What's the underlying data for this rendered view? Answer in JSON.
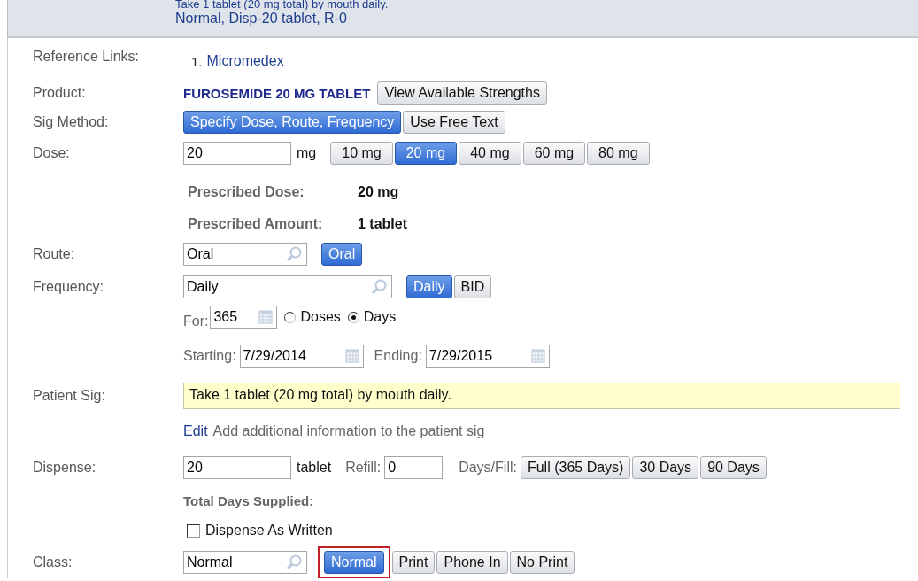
{
  "header": {
    "lines": [
      "Take 1 tablet (20 mg total) by mouth daily.",
      "Normal, Disp-20 tablet, R-0"
    ]
  },
  "reference_links": {
    "label": "Reference Links:",
    "links": [
      {
        "number": "1.",
        "text": "Micromedex"
      }
    ]
  },
  "product": {
    "label": "Product:",
    "name": "FUROSEMIDE 20 MG TABLET",
    "button": "View Available Strengths"
  },
  "sig_method": {
    "label": "Sig Method:",
    "options": [
      {
        "label": "Specify Dose, Route, Frequency",
        "selected": true
      },
      {
        "label": "Use Free Text",
        "selected": false
      }
    ]
  },
  "dose": {
    "label": "Dose:",
    "value": "20",
    "unit": "mg",
    "options": [
      {
        "label": "10 mg",
        "selected": false
      },
      {
        "label": "20 mg",
        "selected": true
      },
      {
        "label": "40 mg",
        "selected": false
      },
      {
        "label": "60 mg",
        "selected": false
      },
      {
        "label": "80 mg",
        "selected": false
      }
    ]
  },
  "prescribed": [
    {
      "label": "Prescribed Dose:",
      "value": "20 mg"
    },
    {
      "label": "Prescribed Amount:",
      "value": "1 tablet"
    }
  ],
  "route": {
    "label": "Route:",
    "value": "Oral",
    "options": [
      {
        "label": "Oral",
        "selected": true
      }
    ]
  },
  "frequency": {
    "label": "Frequency:",
    "value": "Daily",
    "options": [
      {
        "label": "Daily",
        "selected": true
      },
      {
        "label": "BID",
        "selected": false
      }
    ]
  },
  "duration": {
    "label": "For:",
    "value": "365",
    "units": [
      {
        "label": "Doses",
        "selected": false
      },
      {
        "label": "Days",
        "selected": true
      }
    ]
  },
  "dates": {
    "start_label": "Starting:",
    "start": "7/29/2014",
    "end_label": "Ending:",
    "end": "7/29/2015"
  },
  "patient_sig": {
    "label": "Patient Sig:",
    "text": "Take 1 tablet (20 mg total) by mouth daily.",
    "edit_link": "Edit",
    "hint": "Add additional information to the patient sig"
  },
  "dispense": {
    "label": "Dispense:",
    "value": "20",
    "unit": "tablet",
    "refill_label": "Refill:",
    "refill": "0",
    "days_fill_label": "Days/Fill:",
    "days_options": [
      "Full (365 Days)",
      "30 Days",
      "90 Days"
    ],
    "total_days_label": "Total Days Supplied:",
    "daw": {
      "label": "Dispense As Written",
      "checked": false
    }
  },
  "class": {
    "label": "Class:",
    "value": "Normal",
    "options": [
      {
        "label": "Normal",
        "selected": true,
        "highlighted": true
      },
      {
        "label": "Print",
        "selected": false,
        "highlighted": false
      },
      {
        "label": "Phone In",
        "selected": false,
        "highlighted": false
      },
      {
        "label": "No Print",
        "selected": false,
        "highlighted": false
      }
    ]
  }
}
